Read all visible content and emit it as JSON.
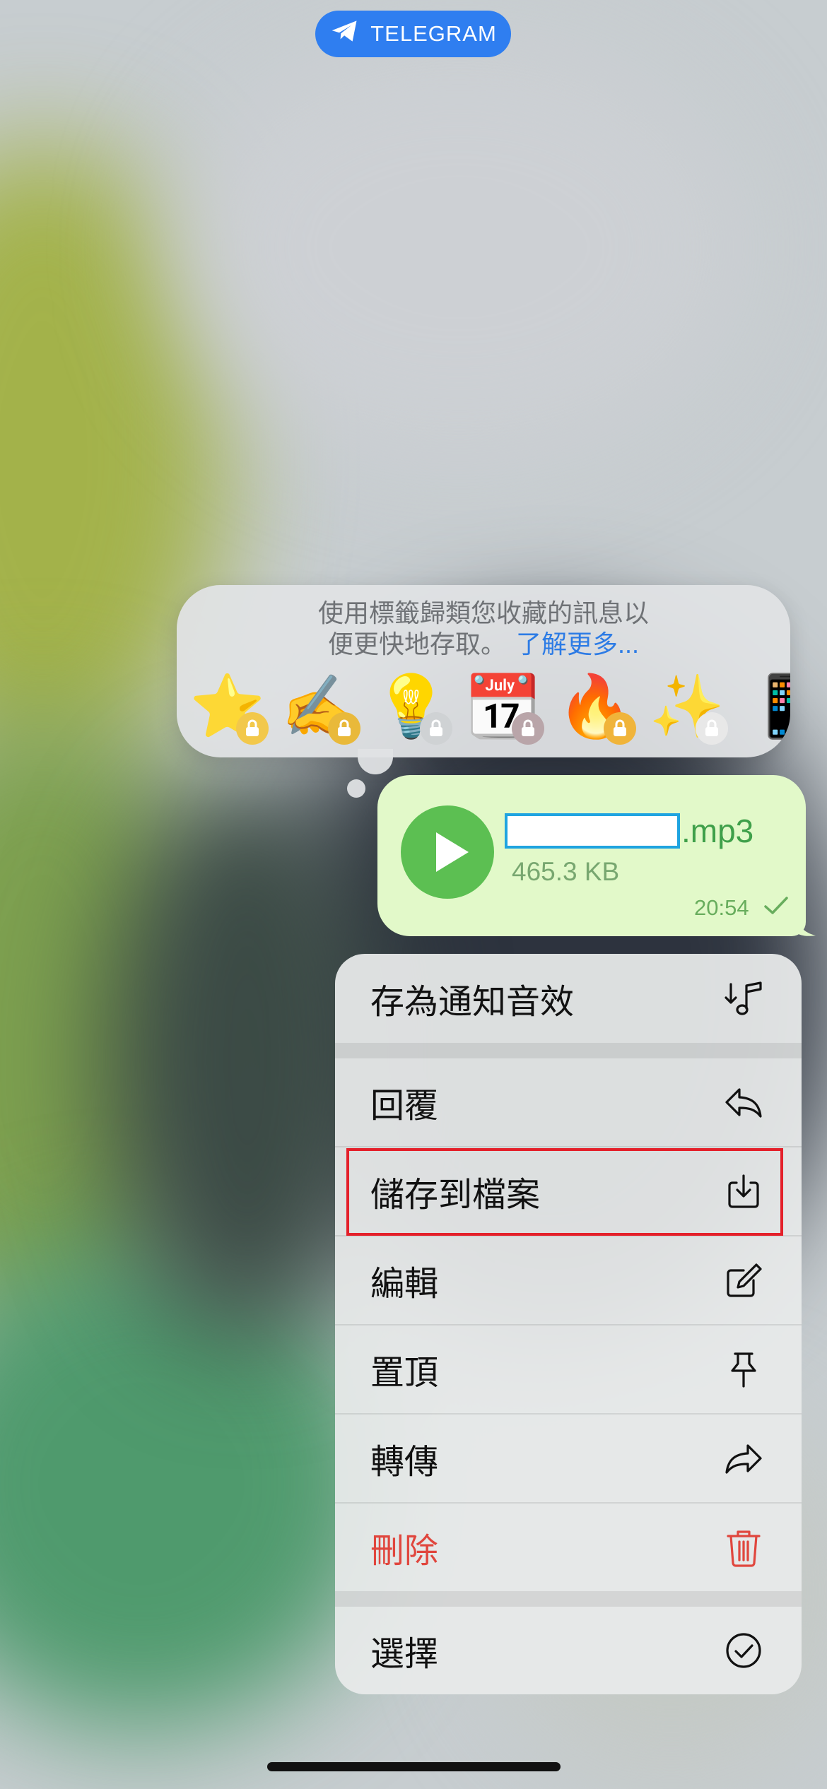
{
  "app_badge": {
    "label": "TELEGRAM",
    "icon": "telegram-plane-icon"
  },
  "reactions_panel": {
    "hint_line1": "使用標籤歸類您收藏的訊息以",
    "hint_line2": "便更快地存取。",
    "learn_more": "了解更多...",
    "emojis": [
      {
        "name": "star-emoji",
        "glyph": "⭐",
        "locked": true
      },
      {
        "name": "writing-hand-emoji",
        "glyph": "✍️",
        "locked": true
      },
      {
        "name": "light-bulb-emoji",
        "glyph": "💡",
        "locked": true
      },
      {
        "name": "calendar-emoji",
        "glyph": "📆",
        "locked": true
      },
      {
        "name": "fire-emoji",
        "glyph": "🔥",
        "locked": true
      },
      {
        "name": "spark-emoji",
        "glyph": "✨",
        "locked": true
      },
      {
        "name": "partial-emoji",
        "glyph": "📱",
        "locked": false
      }
    ]
  },
  "message": {
    "file_ext": ".mp3",
    "file_size": "465.3 KB",
    "time": "20:54",
    "status_icon": "single-check-icon"
  },
  "menu": {
    "items": [
      {
        "label": "存為通知音效",
        "icon": "note-download-icon"
      },
      {
        "label": "回覆",
        "icon": "reply-icon"
      },
      {
        "label": "儲存到檔案",
        "icon": "save-to-files-icon",
        "highlighted": true
      },
      {
        "label": "編輯",
        "icon": "edit-icon"
      },
      {
        "label": "置頂",
        "icon": "pin-icon"
      },
      {
        "label": "轉傳",
        "icon": "forward-icon"
      },
      {
        "label": "刪除",
        "icon": "trash-icon",
        "destructive": true
      },
      {
        "label": "選擇",
        "icon": "select-check-icon"
      }
    ]
  },
  "colors": {
    "accent": "#2f7ef0",
    "bubble": "#e2f9c9",
    "play": "#5cbf52",
    "destructive": "#e0463d",
    "highlight_border": "#e4202a",
    "link": "#2c7be5"
  }
}
